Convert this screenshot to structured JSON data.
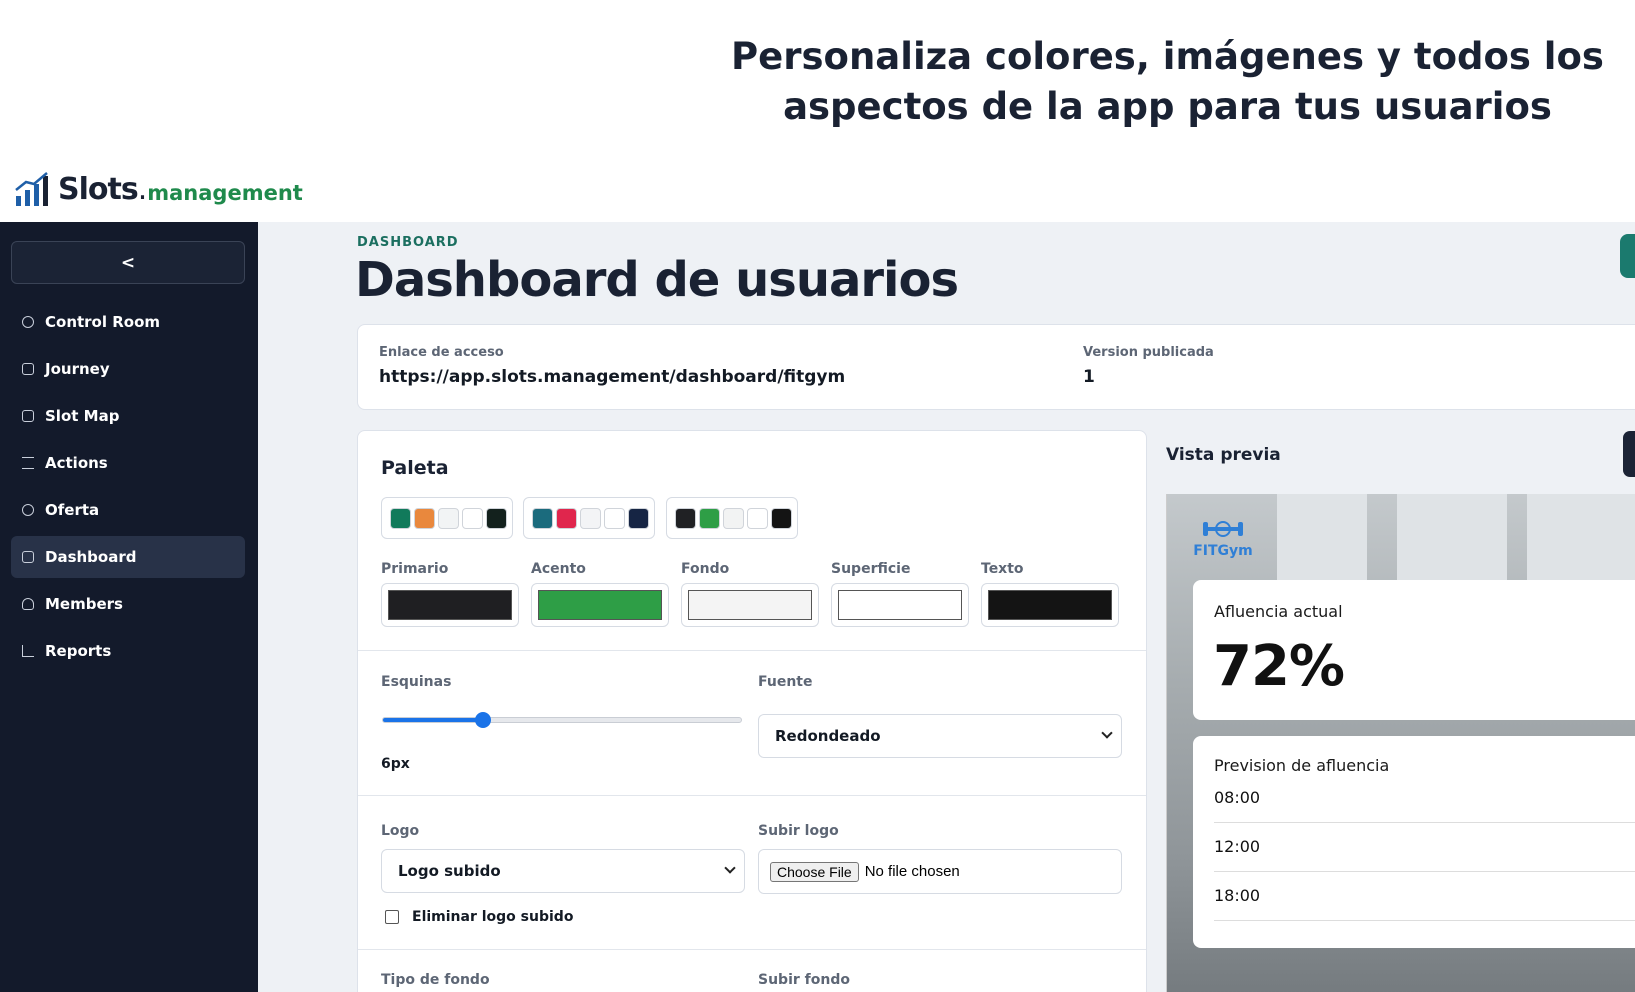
{
  "hero": {
    "line1": "Personaliza colores, imágenes y todos los",
    "line2": "aspectos de la app para tus usuarios"
  },
  "brand": {
    "name": "Slots",
    "dot": ".",
    "suffix": "management"
  },
  "sidebar": {
    "collapse_label": "<",
    "items": [
      {
        "label": "Control Room",
        "icon": "gauge-icon"
      },
      {
        "label": "Journey",
        "icon": "route-icon"
      },
      {
        "label": "Slot Map",
        "icon": "calendar-icon"
      },
      {
        "label": "Actions",
        "icon": "checklist-icon"
      },
      {
        "label": "Oferta",
        "icon": "copyright-icon"
      },
      {
        "label": "Dashboard",
        "icon": "dashboard-icon",
        "active": true
      },
      {
        "label": "Members",
        "icon": "users-icon"
      },
      {
        "label": "Reports",
        "icon": "chart-icon"
      }
    ]
  },
  "header": {
    "eyebrow": "DASHBOARD",
    "title": "Dashboard de usuarios"
  },
  "access": {
    "link_label": "Enlace de acceso",
    "link_value": "https://app.slots.management/dashboard/fitgym",
    "version_label": "Version publicada",
    "version_value": "1"
  },
  "palette": {
    "title": "Paleta",
    "presets": [
      [
        "#117a5b",
        "#e9883d",
        "#f2f4f5",
        "#ffffff",
        "#13211d"
      ],
      [
        "#1b6b7d",
        "#e0264d",
        "#f3f4f6",
        "#ffffff",
        "#162544"
      ],
      [
        "#202124",
        "#2e9e46",
        "#f2f3f3",
        "#ffffff",
        "#141414"
      ]
    ],
    "colors": [
      {
        "label": "Primario",
        "value": "#1f1f22"
      },
      {
        "label": "Acento",
        "value": "#2e9e46"
      },
      {
        "label": "Fondo",
        "value": "#f4f4f4"
      },
      {
        "label": "Superficie",
        "value": "#ffffff"
      },
      {
        "label": "Texto",
        "value": "#141414"
      }
    ]
  },
  "corners": {
    "label": "Esquinas",
    "value": "6px",
    "fraction": 0.28
  },
  "font": {
    "label": "Fuente",
    "selected": "Redondeado"
  },
  "logo": {
    "label": "Logo",
    "selected": "Logo subido",
    "upload_label": "Subir logo",
    "choose_label": "Choose File",
    "no_file": "No file chosen",
    "remove_label": "Eliminar logo subido"
  },
  "background": {
    "type_label": "Tipo de fondo",
    "upload_label": "Subir fondo"
  },
  "preview": {
    "title": "Vista previa",
    "logo_text": "FITGym",
    "occupancy_label": "Afluencia actual",
    "occupancy_value": "72%",
    "forecast_label": "Prevision de afluencia",
    "forecast_times": [
      "08:00",
      "12:00",
      "18:00"
    ]
  }
}
